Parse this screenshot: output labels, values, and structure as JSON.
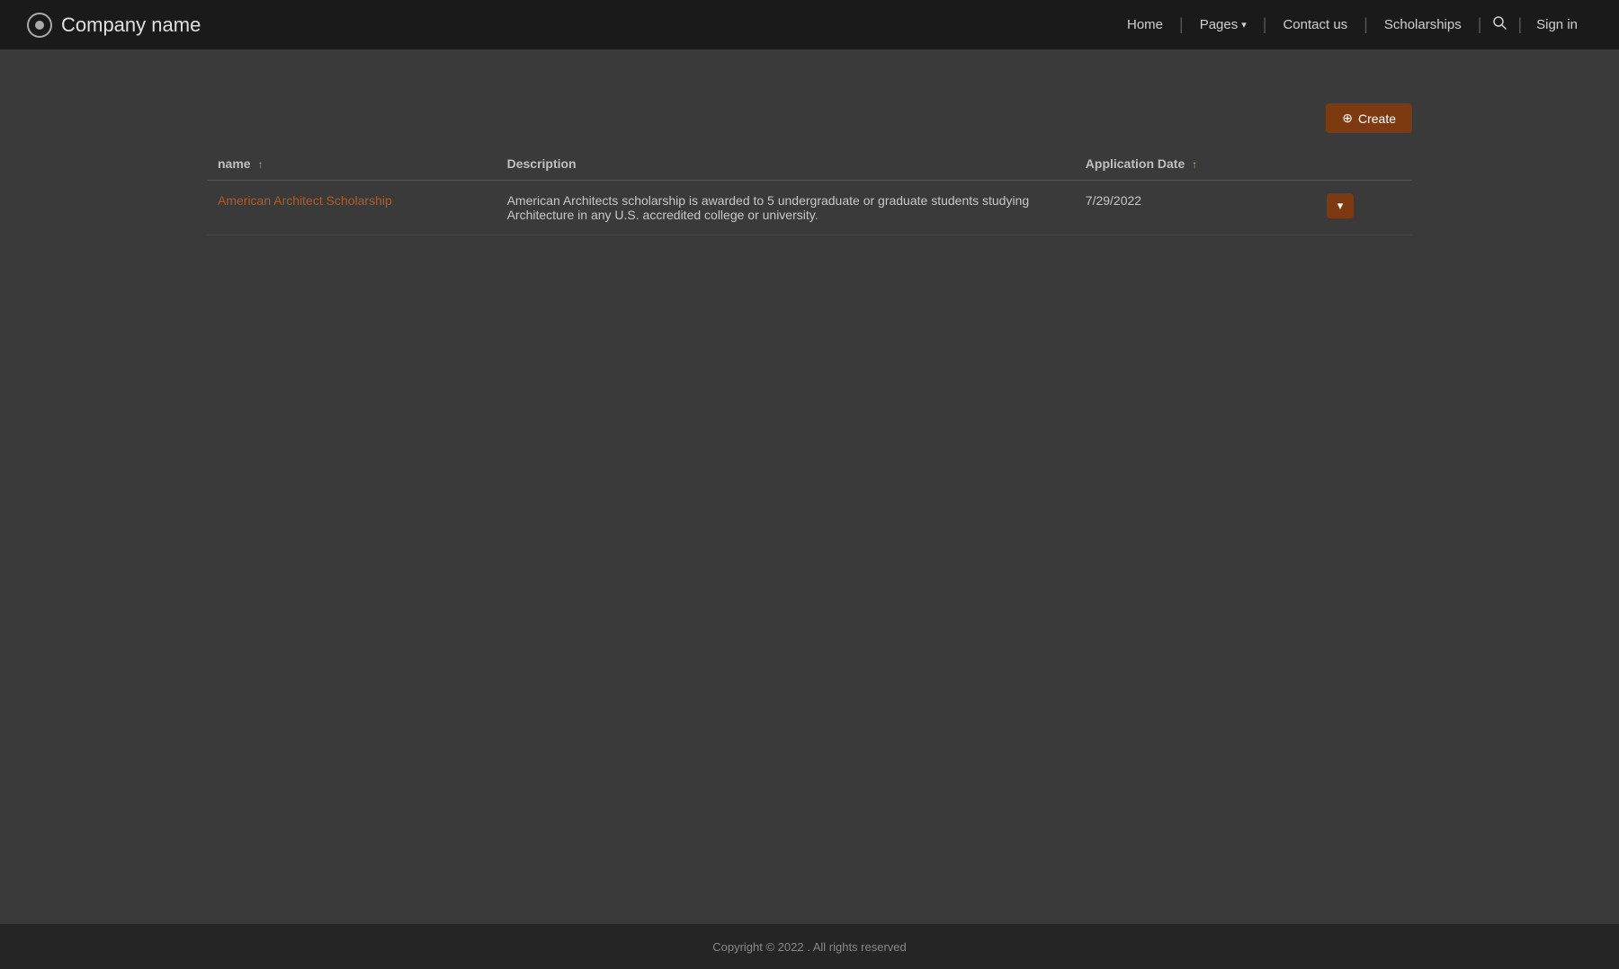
{
  "navbar": {
    "brand": {
      "icon_name": "circle-dot-icon",
      "title": "Company name"
    },
    "nav_items": [
      {
        "label": "Home",
        "key": "home",
        "has_dropdown": false
      },
      {
        "label": "Pages",
        "key": "pages",
        "has_dropdown": true
      },
      {
        "label": "Contact us",
        "key": "contact"
      },
      {
        "label": "Scholarships",
        "key": "scholarships"
      }
    ],
    "search_label": "search",
    "signin_label": "Sign in"
  },
  "toolbar": {
    "create_label": "Create",
    "create_icon": "plus-icon"
  },
  "table": {
    "columns": [
      {
        "key": "name",
        "label": "name",
        "sortable": true
      },
      {
        "key": "description",
        "label": "Description",
        "sortable": false
      },
      {
        "key": "application_date",
        "label": "Application Date",
        "sortable": true
      }
    ],
    "rows": [
      {
        "name": "American Architect Scholarship",
        "description": "American Architects scholarship is awarded to 5 undergraduate or graduate students studying Architecture in any U.S. accredited college or university.",
        "application_date": "7/29/2022"
      }
    ],
    "action_button_label": "▾"
  },
  "footer": {
    "copyright": "Copyright © 2022 . All rights reserved"
  }
}
